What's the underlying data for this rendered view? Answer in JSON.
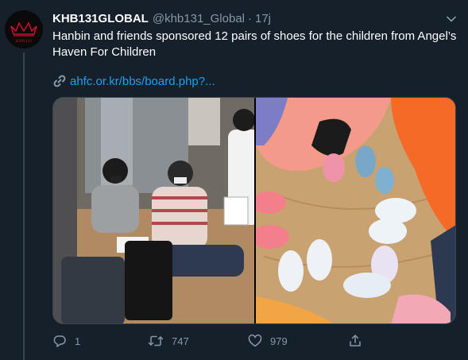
{
  "tweet": {
    "display_name": "KHB131GLOBAL",
    "handle": "@khb131_Global",
    "separator": "·",
    "time": "17j",
    "text": "Hanbin and friends sponsored 12 pairs of shoes for the children from Angel’s Haven For Children",
    "link_text": "ahfc.or.kr/bbs/board.php?...",
    "avatar_logo_text": "KHB·131"
  },
  "actions": {
    "reply_count": "1",
    "retweet_count": "747",
    "like_count": "979"
  },
  "icons": {
    "caret": "chevron-down-icon",
    "link": "link-icon",
    "reply": "reply-icon",
    "retweet": "retweet-icon",
    "like": "heart-icon",
    "share": "share-icon"
  },
  "colors": {
    "background": "#15202b",
    "text": "#ffffff",
    "secondary": "#8899a6",
    "link": "#1da1f2",
    "border": "#38444d",
    "avatar_accent": "#c8102e"
  }
}
